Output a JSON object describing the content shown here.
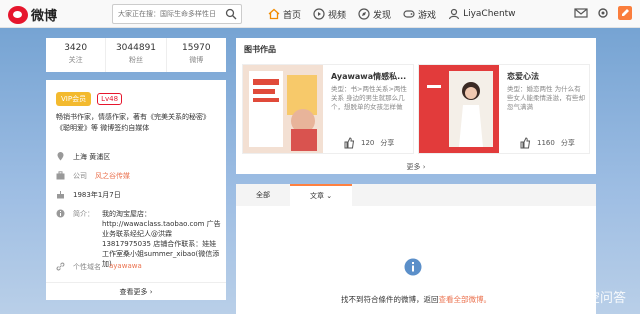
{
  "header": {
    "logo_text": "微博",
    "search_placeholder": "大家正在搜：国际生命多样性日",
    "nav": [
      {
        "label": "首页",
        "icon": "home-icon"
      },
      {
        "label": "视频",
        "icon": "video-icon"
      },
      {
        "label": "发现",
        "icon": "discover-icon"
      },
      {
        "label": "游戏",
        "icon": "game-icon"
      },
      {
        "label": "LiyaChentw",
        "icon": "user-icon"
      }
    ]
  },
  "stats": [
    {
      "value": "3420",
      "label": "关注"
    },
    {
      "value": "3044891",
      "label": "粉丝"
    },
    {
      "value": "15970",
      "label": "微博"
    }
  ],
  "profile": {
    "vip_label": "VIP会员",
    "level_label": "Lv48",
    "bio": "畅销书作家，情感作家，著有《完美关系的秘密》《聪明爱》等 微博签约自媒体",
    "location": "上海 黄浦区",
    "company_label": "公司",
    "company": "风之谷传媒",
    "birthday": "1983年1月7日",
    "intro_label": "简介：",
    "intro": "我的淘宝屋店：http://wawaclass.taobao.com 广告业务联系经纪人@洪霖 13817975035 店铺合作联系：娃娃工作室桑小姐summer_xibao(微信添加)",
    "domain_label": "个性域名",
    "domain": "ayawawa",
    "more": "查看更多 ›"
  },
  "books": {
    "title": "图书作品",
    "items": [
      {
        "title": "Ayawawa情感私...",
        "desc": "类型：书>两性关系>两性关系 身边的男生就那么几个，想脱单的女孩怎样做",
        "likes": "120",
        "share": "分享"
      },
      {
        "title": "恋爱心法",
        "desc": "类型：婚恋两性 为什么有些女人能柔情涟滋，有些却忽气满满",
        "likes": "1160",
        "share": "分享"
      }
    ],
    "more": "更多 ›"
  },
  "tabs": [
    {
      "label": "全部"
    },
    {
      "label": "文章 ⌄"
    }
  ],
  "empty": {
    "message": "找不到符合條件的微博，返回",
    "link": "查看全部微博。"
  },
  "watermark": "悟空问答"
}
